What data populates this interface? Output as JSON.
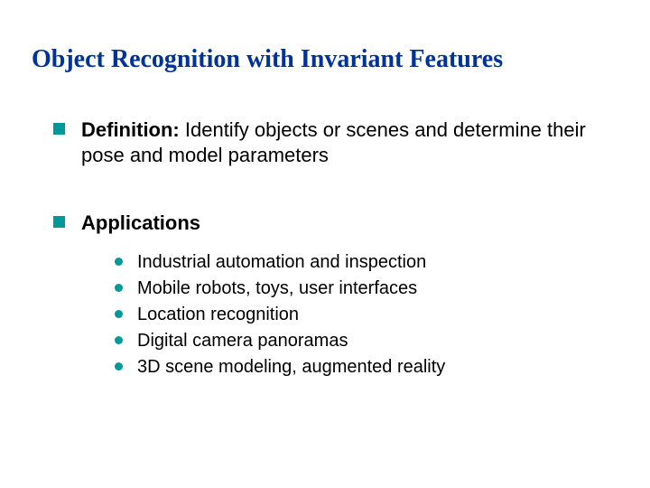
{
  "title": "Object Recognition with Invariant Features",
  "bullets": [
    {
      "label": "Definition:",
      "body": " Identify objects or scenes and determine their pose and model parameters"
    },
    {
      "label": "Applications",
      "body": ""
    }
  ],
  "subbullets": [
    "Industrial automation and inspection",
    "Mobile robots, toys, user interfaces",
    "Location recognition",
    "Digital camera panoramas",
    "3D scene modeling, augmented reality"
  ]
}
